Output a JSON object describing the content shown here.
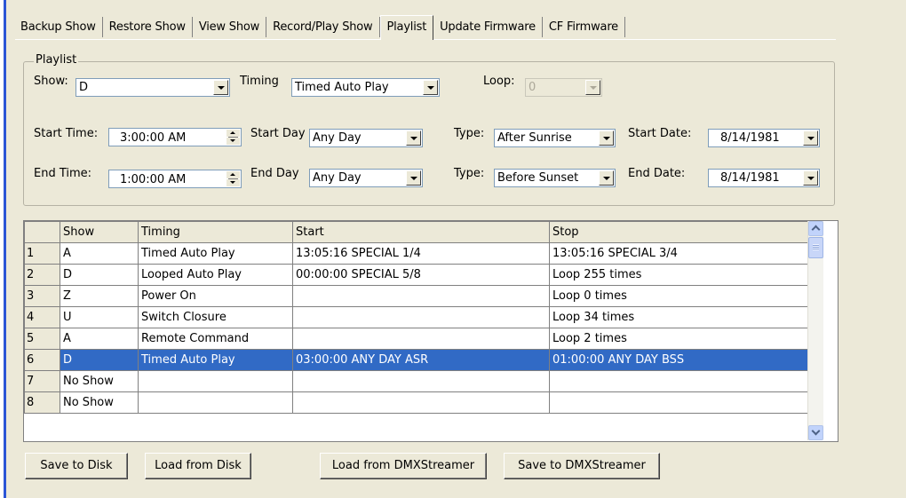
{
  "tabs": [
    {
      "label": "Backup Show"
    },
    {
      "label": "Restore Show"
    },
    {
      "label": "View Show"
    },
    {
      "label": "Record/Play Show"
    },
    {
      "label": "Playlist",
      "active": true
    },
    {
      "label": "Update Firmware"
    },
    {
      "label": "CF Firmware"
    }
  ],
  "playlist": {
    "group_title": "Playlist",
    "show_label": "Show:",
    "show_value": "D",
    "timing_label": "Timing",
    "timing_value": "Timed Auto Play",
    "loop_label": "Loop:",
    "loop_value": "0",
    "start_time_label": "Start Time:",
    "start_time_value": "3:00:00 AM",
    "start_day_label": "Start Day",
    "start_day_value": "Any Day",
    "start_type_label": "Type:",
    "start_type_value": "After Sunrise",
    "start_date_label": "Start Date:",
    "start_date_value": "8/14/1981",
    "end_time_label": "End Time:",
    "end_time_value": "1:00:00 AM",
    "end_day_label": "End Day",
    "end_day_value": "Any Day",
    "end_type_label": "Type:",
    "end_type_value": "Before Sunset",
    "end_date_label": "End Date:",
    "end_date_value": "8/14/1981"
  },
  "grid": {
    "columns": [
      "",
      "Show",
      "Timing",
      "Start",
      "Stop"
    ],
    "rows": [
      {
        "num": "1",
        "show": "A",
        "timing": "Timed Auto Play",
        "start": "13:05:16 SPECIAL 1/4",
        "stop": "13:05:16 SPECIAL 3/4"
      },
      {
        "num": "2",
        "show": "D",
        "timing": "Looped Auto Play",
        "start": "00:00:00 SPECIAL 5/8",
        "stop": "Loop 255 times"
      },
      {
        "num": "3",
        "show": "Z",
        "timing": "Power On",
        "start": "",
        "stop": "Loop 0 times"
      },
      {
        "num": "4",
        "show": "U",
        "timing": "Switch Closure",
        "start": "",
        "stop": "Loop 34 times"
      },
      {
        "num": "5",
        "show": "A",
        "timing": "Remote Command",
        "start": "",
        "stop": "Loop 2 times"
      },
      {
        "num": "6",
        "show": "D",
        "timing": "Timed Auto Play",
        "start": "03:00:00 ANY DAY ASR",
        "stop": "01:00:00 ANY DAY BSS",
        "selected": true
      },
      {
        "num": "7",
        "show": "No Show",
        "timing": "",
        "start": "",
        "stop": ""
      },
      {
        "num": "8",
        "show": "No Show",
        "timing": "",
        "start": "",
        "stop": ""
      }
    ]
  },
  "buttons": {
    "save_disk": "Save to Disk",
    "load_disk": "Load from Disk",
    "load_dmx": "Load from DMXStreamer",
    "save_dmx": "Save to DMXStreamer"
  }
}
